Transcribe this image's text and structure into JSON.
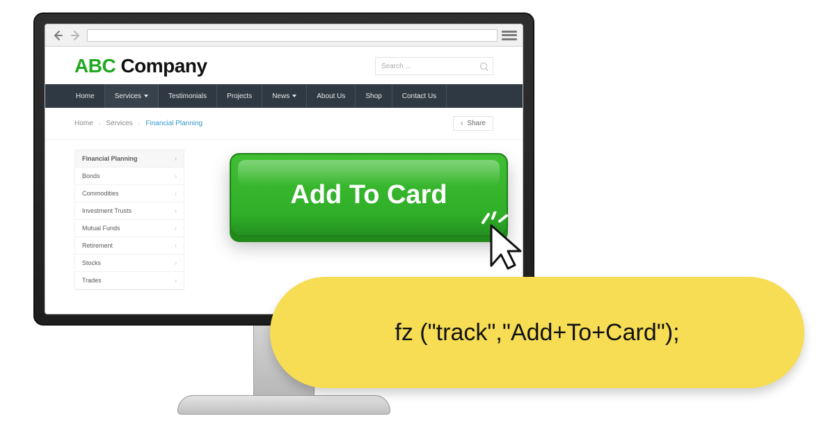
{
  "logo": {
    "abc": "ABC",
    "rest": " Company"
  },
  "search": {
    "placeholder": "Search ..."
  },
  "nav": {
    "items": [
      {
        "label": "Home",
        "caret": false,
        "active": false
      },
      {
        "label": "Services",
        "caret": true,
        "active": true
      },
      {
        "label": "Testimonials",
        "caret": false,
        "active": false
      },
      {
        "label": "Projects",
        "caret": false,
        "active": false
      },
      {
        "label": "News",
        "caret": true,
        "active": false
      },
      {
        "label": "About Us",
        "caret": false,
        "active": false
      },
      {
        "label": "Shop",
        "caret": false,
        "active": false
      },
      {
        "label": "Contact Us",
        "caret": false,
        "active": false
      }
    ]
  },
  "breadcrumb": {
    "home": "Home",
    "services": "Services",
    "current": "Financial Planning",
    "share": "Share"
  },
  "sidebar": {
    "items": [
      {
        "label": "Financial Planning",
        "selected": true
      },
      {
        "label": "Bonds",
        "selected": false
      },
      {
        "label": "Commodities",
        "selected": false
      },
      {
        "label": "Investment Trusts",
        "selected": false
      },
      {
        "label": "Mutual Funds",
        "selected": false
      },
      {
        "label": "Retirement",
        "selected": false
      },
      {
        "label": "Stocks",
        "selected": false
      },
      {
        "label": "Trades",
        "selected": false
      }
    ]
  },
  "cta_label": "Add To Card",
  "code_snippet": "fz (\"track\",\"Add+To+Card\");"
}
